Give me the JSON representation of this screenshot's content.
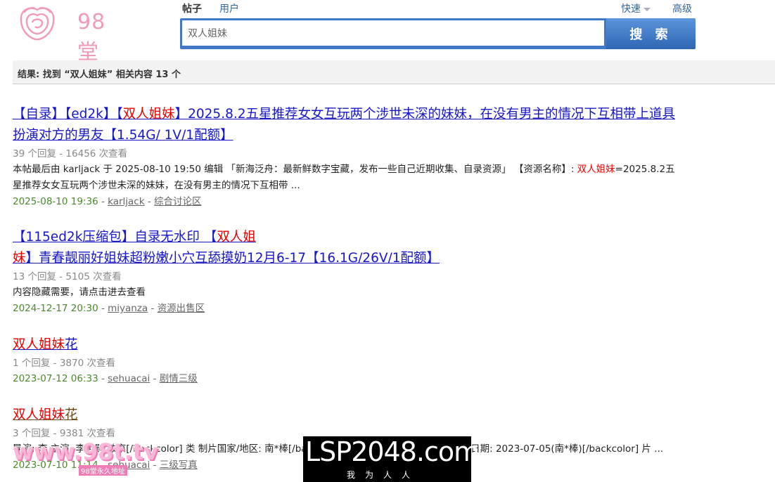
{
  "logo": {
    "text": "98堂"
  },
  "tabs": [
    {
      "label": "帖子",
      "active": true
    },
    {
      "label": "用户",
      "active": false
    }
  ],
  "quick_label": "快速",
  "advanced_label": "高级",
  "search": {
    "value": "双人姐妹",
    "button_label": "搜 索"
  },
  "result_summary": "结果: 找到 “双人姐妹” 相关内容 13 个",
  "results": [
    {
      "title_pre": "【自录】【ed2k】【",
      "title_kw": "双人姐妹",
      "title_post": "】2025.8.2五星推荐女女互玩两个涉世未深的妹妹，在没有男主的情况下互相带上道具扮演对方的男友【1.54G/ 1V/1配额】",
      "stats": "39 个回复 - 16456 次查看",
      "desc_pre": "本帖最后由 karljack 于 2025-08-10 19:50 编辑 「新海泛舟：最新鲜数字宝藏，发布一些自己近期收集、自录资源」 【资源名称】: ",
      "desc_kw": "双人姐妹",
      "desc_post": "=2025.8.2五星推荐女女互玩两个涉世未深的妹妹，在没有男主的情况下互相带 ...",
      "date": "2025-08-10 19:36",
      "author": "karljack",
      "forum": "综合讨论区"
    },
    {
      "title_pre": "【115ed2k压缩包】自录无水印 【",
      "title_kw": "双人姐妹",
      "title_post": "】青春靓丽好姐妹超粉嫩小穴互舔摸奶12月6-17【16.1G/26V/1配额】",
      "stats": "13 个回复 - 5105 次查看",
      "desc_pre": "内容隐藏需要，请点击进去查看",
      "desc_kw": "",
      "desc_post": "",
      "date": "2024-12-17 20:30",
      "author": "miyanza",
      "forum": "资源出售区"
    },
    {
      "title_pre": "",
      "title_kw": "双人姐妹",
      "title_post": "花",
      "stats": "1 个回复 - 3870 次查看",
      "desc_pre": "",
      "desc_kw": "",
      "desc_post": "",
      "date": "2023-07-12 06:33",
      "author": "sehuacai",
      "forum": "剧情三级"
    },
    {
      "title_pre": "",
      "title_kw": "双人姐妹",
      "title_post": "花",
      "stats": "3 个回复 - 9381 次查看",
      "desc_pre": "导演: 李 主演: 李相勋 敏京[/backcolor] 类 制片国家/地区: 南*棒[/backcolor] 语言: 韩语[/backcolor] 上映日期: 2023-07-05(南*棒)[/backcolor] 片 ...",
      "desc_kw": "",
      "desc_post": "",
      "date": "2023-07-10 11:14",
      "author": "sehuacai",
      "forum": "三级写真"
    }
  ],
  "watermarks": {
    "left_big": "www.98t.tv",
    "left_small": "98堂永久地址",
    "right_big": "LSP2048.com",
    "right_small": "我为人人"
  }
}
